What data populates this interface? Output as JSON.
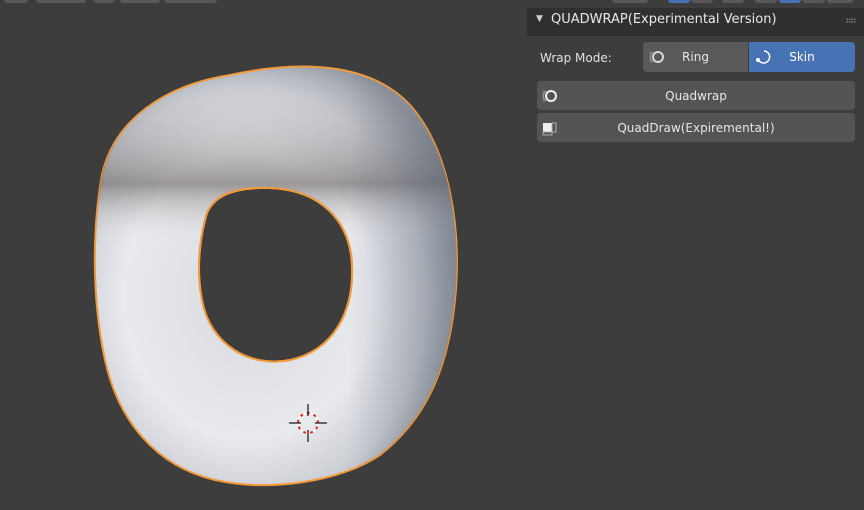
{
  "panel": {
    "title": "QUADWRAP(Experimental Version)",
    "collapse_icon": "disclosure-triangle-down-icon",
    "drag_icon": "drag-handle-icon"
  },
  "wrap_mode": {
    "label": "Wrap Mode:",
    "options": [
      {
        "label": "Ring",
        "icon": "ring-icon",
        "selected": false
      },
      {
        "label": "Skin",
        "icon": "skin-icon",
        "selected": true
      }
    ]
  },
  "buttons": {
    "quadwrap": {
      "label": "Quadwrap",
      "icon": "quadwrap-icon"
    },
    "quaddraw": {
      "label": "QuadDraw(Expiremental!)",
      "icon": "quaddraw-icon"
    }
  },
  "viewport": {
    "object": "torus-mesh",
    "selection_outline_color": "#f29a3a",
    "background_color": "#3d3d3d",
    "cursor": "3d-cursor-icon"
  },
  "colors": {
    "accent": "#4772b3",
    "panel_bg": "#303030",
    "button_bg": "#545454"
  }
}
